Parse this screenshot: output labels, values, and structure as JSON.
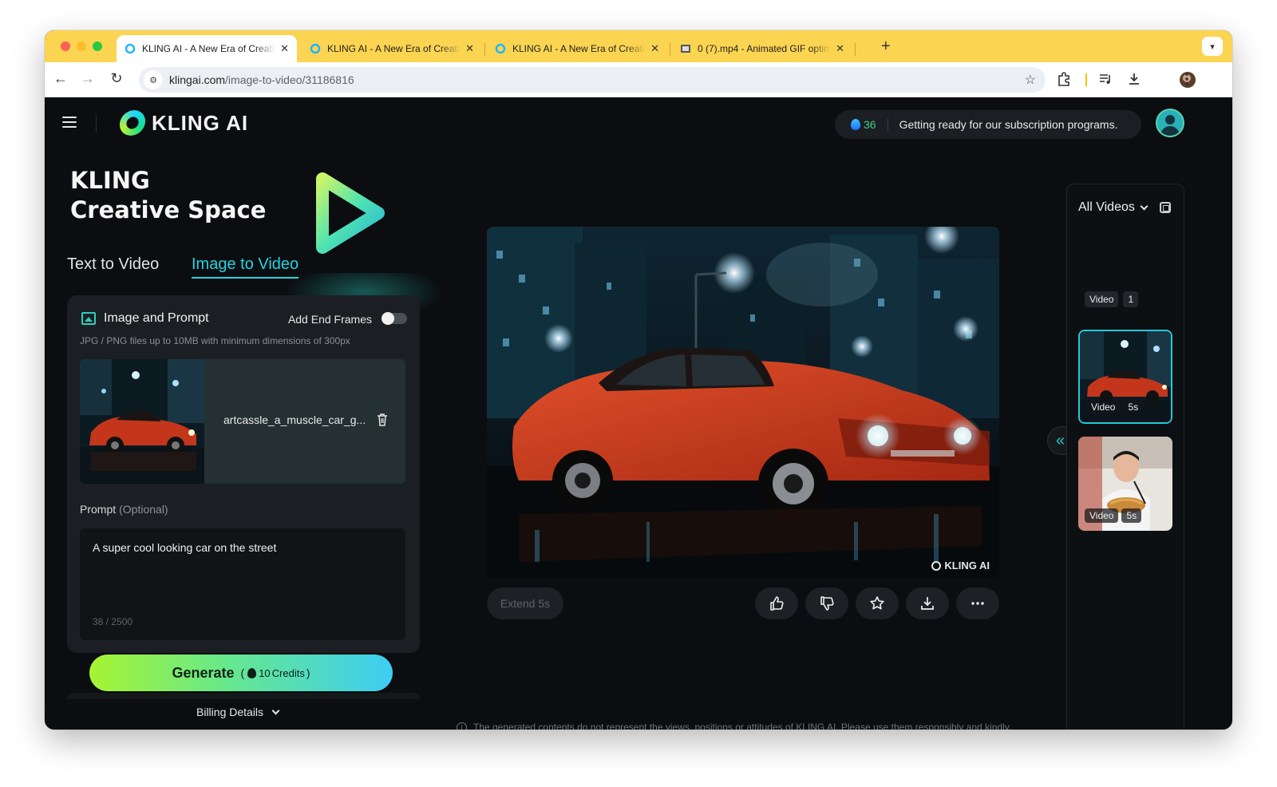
{
  "browser": {
    "tabs": [
      {
        "title": "KLING AI - A New Era of Creative",
        "close": "✕"
      },
      {
        "title": "KLING AI - A New Era of Creative",
        "close": "✕"
      },
      {
        "title": "KLING AI - A New Era of Creative",
        "close": "✕"
      },
      {
        "title": "0 (7).mp4 - Animated GIF optimizer",
        "close": "✕"
      }
    ],
    "new_tab": "+",
    "url_host": "klingai.com",
    "url_path": "/image-to-video/31186816",
    "accent": "#fbd451"
  },
  "header": {
    "logo": "KLING AI",
    "credits": "36",
    "notice": "Getting ready for our subscription programs."
  },
  "hero": {
    "line1": "KLING",
    "line2": "Creative Space"
  },
  "modes": {
    "text_to_video": "Text to Video",
    "image_to_video": "Image to Video"
  },
  "card": {
    "title": "Image and Prompt",
    "end_frames": "Add End Frames",
    "hint": "JPG / PNG files up to 10MB with minimum dimensions of 300px",
    "file_name": "artcassle_a_muscle_car_g...",
    "prompt_label": "Prompt",
    "prompt_optional": "(Optional)",
    "prompt_text": "A super cool looking car on the street",
    "char_count": "38 / 2500"
  },
  "generate": {
    "label": "Generate",
    "credits": "10",
    "credits_unit": "Credits"
  },
  "billing": "Billing Details",
  "player": {
    "watermark": "KLING AI",
    "extend": "Extend 5s"
  },
  "disclaimer": "The generated contents do not represent the views, positions or attitudes of KLING AI. Please use them responsibly and kindly.",
  "sidebar": {
    "filter": "All Videos",
    "group_label": "Video",
    "group_count": "1",
    "items": [
      {
        "type": "Video",
        "duration": "5s"
      },
      {
        "type": "Video",
        "duration": "5s"
      }
    ]
  }
}
